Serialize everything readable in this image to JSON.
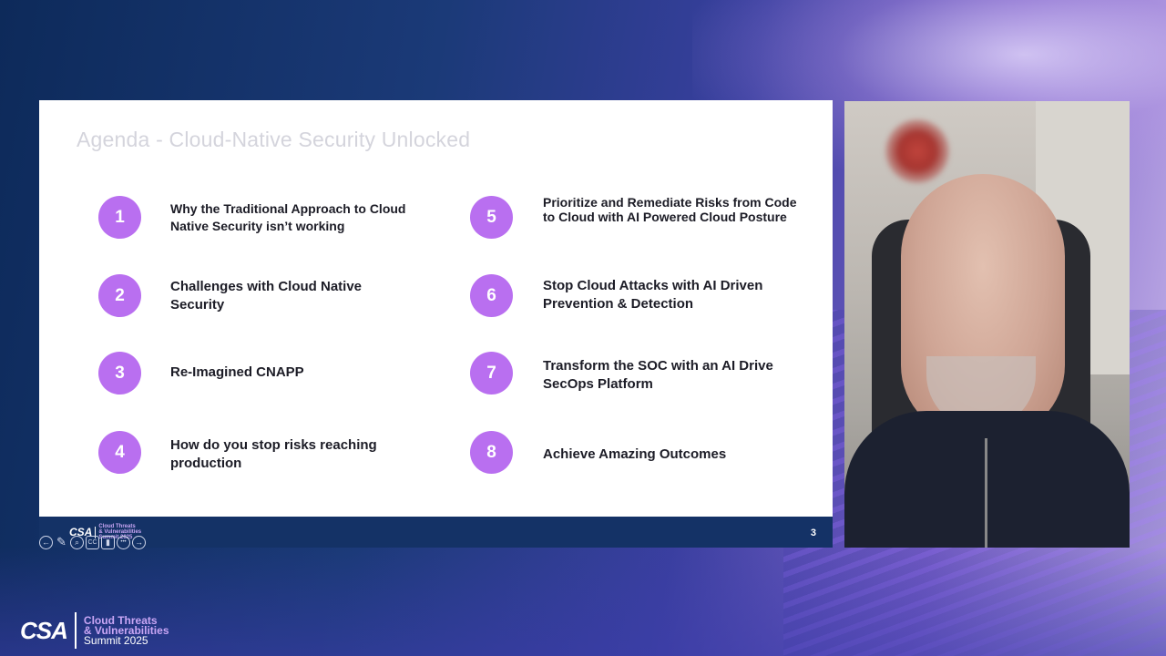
{
  "slide": {
    "title": "Agenda - Cloud-Native Security Unlocked",
    "page_number": "3",
    "items": [
      {
        "num": "1",
        "text": "Why the Traditional Approach to Cloud Native Security isn’t working"
      },
      {
        "num": "2",
        "text": "Challenges with Cloud Native Security"
      },
      {
        "num": "3",
        "text": "Re-Imagined CNAPP"
      },
      {
        "num": "4",
        "text": "How do you stop risks reaching production"
      },
      {
        "num": "5",
        "text": "Prioritize and Remediate Risks from Code to Cloud with AI Powered Cloud Posture"
      },
      {
        "num": "6",
        "text": "Stop Cloud Attacks with AI Driven Prevention & Detection"
      },
      {
        "num": "7",
        "text": "Transform the SOC with an AI Drive SecOps Platform"
      },
      {
        "num": "8",
        "text": "Achieve Amazing Outcomes"
      }
    ]
  },
  "mini_logo": {
    "csa": "CSA",
    "line1": "Cloud Threats",
    "line2": "& Vulnerabilities",
    "line3": "Summit 2025"
  },
  "controls": [
    "back-icon",
    "pen-icon",
    "zoom-icon",
    "cc-icon",
    "camera-icon",
    "more-icon",
    "forward-icon"
  ],
  "controls_glyphs": {
    "back": "←",
    "pen": "✎",
    "zoom": "⌕",
    "cc": "CC",
    "camera": "▮",
    "more": "•••",
    "forward": "→"
  },
  "brand": {
    "csa": "CSA",
    "line1": "Cloud Threats",
    "line2": "& Vulnerabilities",
    "line3": "Summit 2025"
  },
  "colors": {
    "accent": "#b96ff0",
    "footer": "#143266",
    "brand_text": "#c9a6f5"
  }
}
